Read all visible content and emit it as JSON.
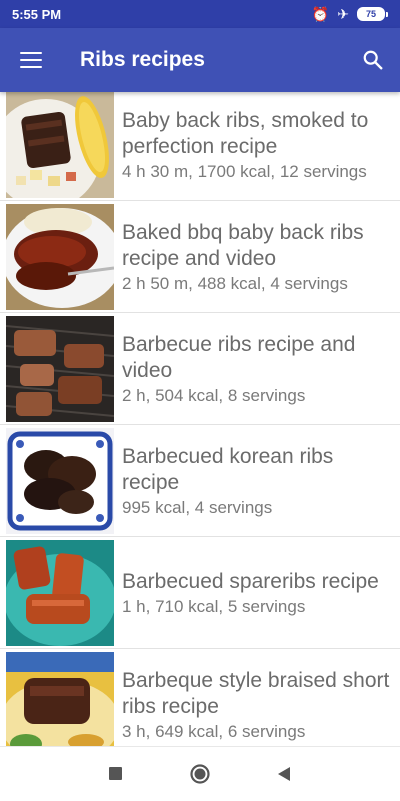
{
  "status_bar": {
    "time": "5:55 PM",
    "icons": [
      "alarm-icon",
      "airplane-icon"
    ],
    "battery_level": "75"
  },
  "app_bar": {
    "title": "Ribs recipes",
    "menu_icon": "menu-icon",
    "search_icon": "search-icon",
    "color": "#3f51b5"
  },
  "recipes": [
    {
      "title": "Baby back ribs, smoked to perfection recipe",
      "meta": "4 h 30 m, 1700 kcal, 12 servings"
    },
    {
      "title": "Baked bbq baby back ribs recipe and video",
      "meta": "2 h 50 m, 488 kcal, 4 servings"
    },
    {
      "title": "Barbecue ribs recipe and video",
      "meta": "2 h, 504 kcal, 8 servings"
    },
    {
      "title": "Barbecued korean ribs recipe",
      "meta": "995 kcal, 4 servings"
    },
    {
      "title": "Barbecued spareribs recipe",
      "meta": "1 h, 710 kcal, 5 servings"
    },
    {
      "title": "Barbeque style braised short ribs recipe",
      "meta": "3 h, 649 kcal, 6 servings"
    }
  ],
  "nav_bar": {
    "icons": [
      "recents-square-icon",
      "home-circle-icon",
      "back-triangle-icon"
    ]
  }
}
